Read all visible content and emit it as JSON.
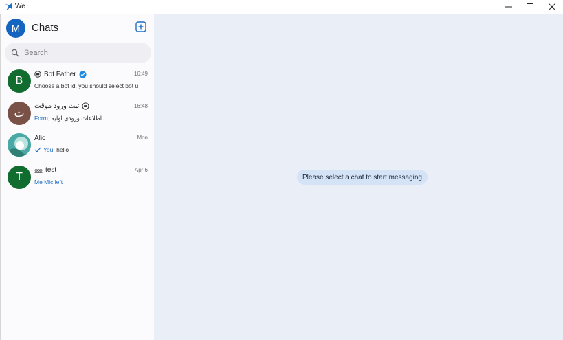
{
  "window": {
    "title": "We",
    "controls": [
      "minimize-icon",
      "maximize-icon",
      "close-icon"
    ]
  },
  "sidebar": {
    "user_initial": "M",
    "title": "Chats",
    "compose_icon": "compose-icon",
    "search": {
      "placeholder": "Search",
      "value": "",
      "icon": "search-icon"
    },
    "chats": [
      {
        "initial": "B",
        "avatar_color": "#116c2f",
        "name": "Bot Father",
        "name_icon": "bot-icon",
        "verified": true,
        "time": "16:49",
        "prefix": "",
        "message": "Choose a bot id, you should select bot u"
      },
      {
        "initial": "ث",
        "avatar_color": "#7a5147",
        "name": "ثبت ورود موقت",
        "name_icon": "bot-icon",
        "verified": false,
        "time": "16:48",
        "prefix": "Form,",
        "message": "اطلاعات ورودی اولیه"
      },
      {
        "initial": "",
        "avatar_color": "#4aa9a6",
        "name": "Alic",
        "name_icon": "",
        "verified": false,
        "time": "Mon",
        "prefix": "You:",
        "message": "hello",
        "status_icon": "check-icon"
      },
      {
        "initial": "T",
        "avatar_color": "#116c2f",
        "name": "test",
        "name_icon": "group-icon",
        "verified": false,
        "time": "Apr 6",
        "prefix": "",
        "message": "Me Mic left",
        "message_accent": true
      }
    ]
  },
  "main": {
    "empty_message": "Please select a chat to start messaging"
  },
  "colors": {
    "accent": "#1d6ec6",
    "main_bg": "#eaeff7",
    "pill_bg": "#d5e3f7",
    "sidebar_bg": "#fbfbfe"
  }
}
